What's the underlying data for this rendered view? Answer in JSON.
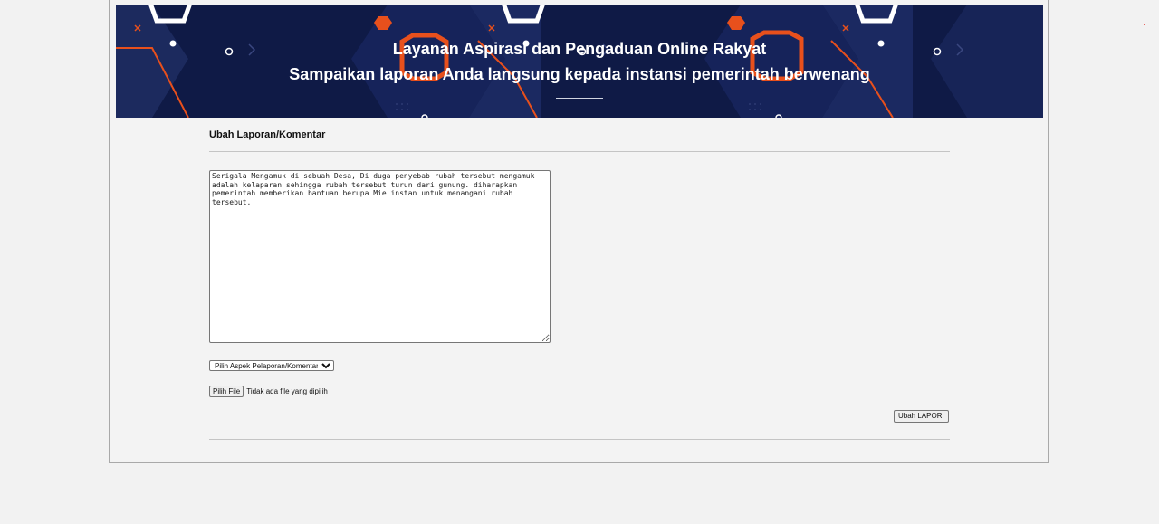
{
  "banner": {
    "title": "Layanan Aspirasi dan Pengaduan Online Rakyat",
    "subtitle": "Sampaikan laporan Anda langsung kepada instansi pemerintah berwenang"
  },
  "form": {
    "heading": "Ubah Laporan/Komentar",
    "report_text": "Serigala Mengamuk di sebuah Desa, Di duga penyebab rubah tersebut mengamuk adalah kelaparan sehingga rubah tersebut turun dari gunung. diharapkan pemerintah memberikan bantuan berupa Mie instan untuk menangani rubah tersebut.",
    "aspect_select": {
      "selected": "Pilih Aspek Pelaporan/Komentar"
    },
    "file_button_label": "Pilih File",
    "file_status": "Tidak ada file yang dipilih",
    "submit_label": "Ubah LAPOR!"
  },
  "colors": {
    "banner_background": "#0f1a46",
    "banner_accent": "#e8501c",
    "page_background": "#f2f2f2"
  }
}
